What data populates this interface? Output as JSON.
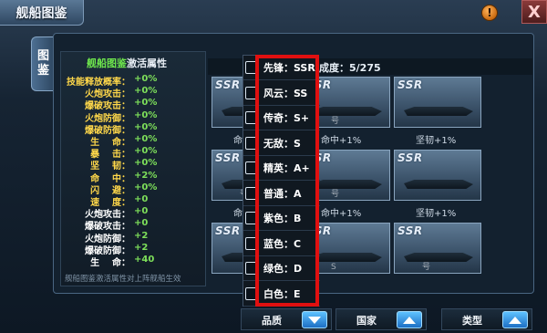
{
  "window": {
    "title": "舰船图鉴",
    "side_tab": [
      "图",
      "鉴"
    ],
    "help_glyph": "!",
    "close_glyph": "X"
  },
  "attributes": {
    "title_green": "舰船图鉴",
    "title_white": "激活属性",
    "rows": [
      {
        "key": "技能释放概率：",
        "value": "+0%",
        "color": "yellow"
      },
      {
        "key": "火炮攻击：",
        "value": "+0%",
        "color": "yellow"
      },
      {
        "key": "爆破攻击：",
        "value": "+0%",
        "color": "yellow"
      },
      {
        "key": "火炮防御：",
        "value": "+0%",
        "color": "yellow"
      },
      {
        "key": "爆破防御：",
        "value": "+0%",
        "color": "yellow"
      },
      {
        "key": "生    命：",
        "value": "+0%",
        "color": "yellow"
      },
      {
        "key": "暴    击：",
        "value": "+0%",
        "color": "yellow"
      },
      {
        "key": "坚    韧：",
        "value": "+0%",
        "color": "yellow"
      },
      {
        "key": "命    中：",
        "value": "+2%",
        "color": "yellow"
      },
      {
        "key": "闪    避：",
        "value": "+0%",
        "color": "yellow"
      },
      {
        "key": "速    度：",
        "value": "+0",
        "color": "yellow"
      },
      {
        "key": "火炮攻击：",
        "value": "+0",
        "color": "white"
      },
      {
        "key": "爆破攻击：",
        "value": "+0",
        "color": "white"
      },
      {
        "key": "火炮防御：",
        "value": "+2",
        "color": "white"
      },
      {
        "key": "爆破防御：",
        "value": "+2",
        "color": "white"
      },
      {
        "key": "生    命：",
        "value": "+40",
        "color": "white"
      }
    ],
    "footer": "舰船图鉴激活属性对上阵舰船生效"
  },
  "collection": {
    "progress": "成度：5/275"
  },
  "cards": [
    {
      "grade": "SSR",
      "name": ""
    },
    {
      "grade": "SSR",
      "name": "号"
    },
    {
      "grade": "SSR",
      "name": ""
    },
    {
      "grade": "SSR",
      "name": "号"
    },
    {
      "grade": "SSR",
      "name": "号"
    },
    {
      "grade": "SSR",
      "name": ""
    },
    {
      "grade": "SSR",
      "name": ""
    },
    {
      "grade": "SSR",
      "name": "S"
    },
    {
      "grade": "SSR",
      "name": "号"
    }
  ],
  "bonuses": [
    "命",
    "命中+1%",
    "坚韧+1%",
    "命",
    "命中+1%",
    "坚韧+1%"
  ],
  "quality_dropdown": {
    "items": [
      {
        "label": "先锋：SSR"
      },
      {
        "label": "风云：SS"
      },
      {
        "label": "传奇：S+"
      },
      {
        "label": "无敌：S"
      },
      {
        "label": "精英：A+"
      },
      {
        "label": "普通：A"
      },
      {
        "label": "紫色：B"
      },
      {
        "label": "蓝色：C"
      },
      {
        "label": "绿色：D"
      },
      {
        "label": "白色：E"
      }
    ]
  },
  "filters": [
    {
      "label": "品质",
      "arrow": "down"
    },
    {
      "label": "国家",
      "arrow": "up"
    },
    {
      "label": "类型",
      "arrow": "up"
    }
  ],
  "colors": {
    "highlight": "#e01010",
    "accent_green": "#6ee64d",
    "label_yellow": "#ffd84a",
    "arrow_blue": "#1d6fc4"
  }
}
